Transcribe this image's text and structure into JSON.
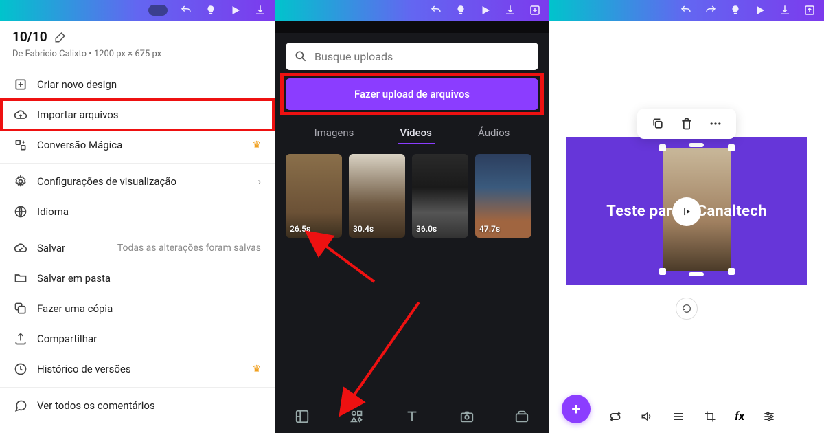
{
  "doc": {
    "title": "10/10",
    "subtitle": "De Fabricio Calixto • 1200 px × 675 px"
  },
  "menu": {
    "create": "Criar novo design",
    "import": "Importar arquivos",
    "magic": "Conversão Mágica",
    "view": "Configurações de visualização",
    "lang": "Idioma",
    "save": "Salvar",
    "save_aside": "Todas as alterações foram salvas",
    "folder": "Salvar em pasta",
    "copy": "Fazer uma cópia",
    "share": "Compartilhar",
    "history": "Histórico de versões",
    "comments": "Ver todos os comentários"
  },
  "uploads": {
    "search_placeholder": "Busque uploads",
    "upload_btn": "Fazer upload de arquivos",
    "tabs": {
      "images": "Imagens",
      "videos": "Vídeos",
      "audios": "Áudios"
    },
    "durations": [
      "26.5s",
      "30.4s",
      "36.0s",
      "47.7s"
    ]
  },
  "canvas": {
    "text": "Teste para o Canaltech"
  },
  "bottom_tools": {
    "fx": "fx"
  }
}
